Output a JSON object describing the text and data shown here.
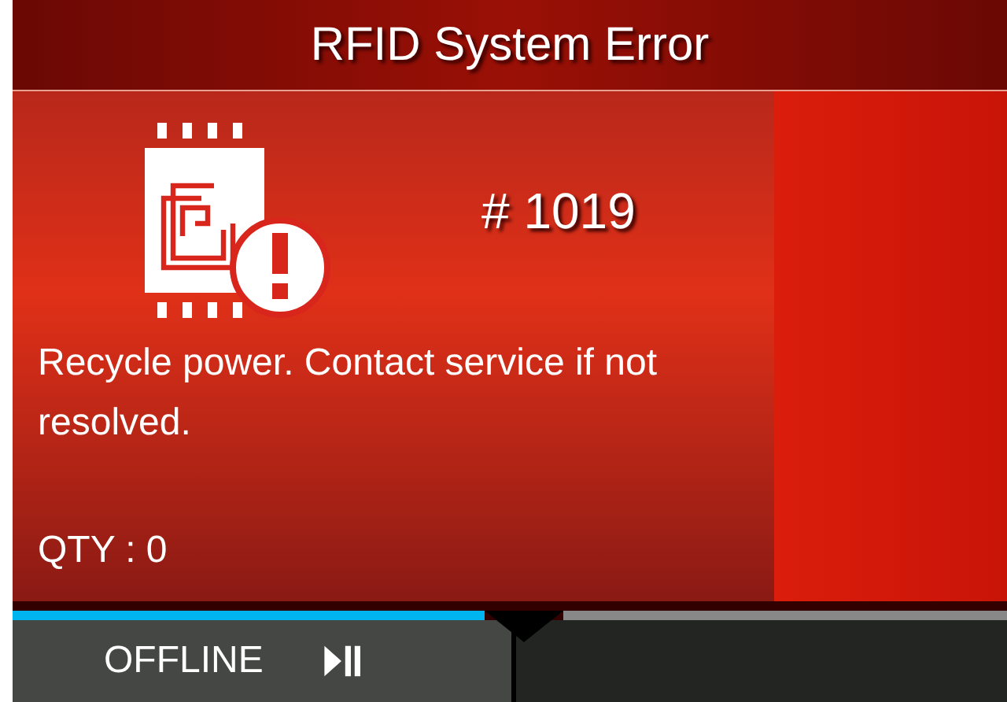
{
  "title": "RFID System Error",
  "error": {
    "code": "# 1019",
    "message": "Recycle power. Contact service if not resolved.",
    "qty": "QTY : 0"
  },
  "softkey": {
    "label": "OFFLINE",
    "selected": true
  }
}
